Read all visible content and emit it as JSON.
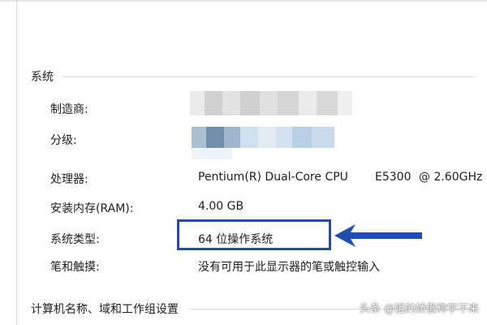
{
  "sections": {
    "system": "系统",
    "computer_name": "计算机名称、域和工作组设置"
  },
  "rows": {
    "manufacturer": {
      "label": "制造商:",
      "value": ""
    },
    "rating": {
      "label": "分级:",
      "value": ""
    },
    "processor": {
      "label": "处理器:",
      "value_main": "Pentium(R) Dual-Core  CPU",
      "value_model": "E5300",
      "value_speed": "@ 2.60GHz"
    },
    "ram": {
      "label": "安装内存(RAM):",
      "value": "4.00 GB"
    },
    "system_type": {
      "label": "系统类型:",
      "value": "64 位操作系统"
    },
    "pen_touch": {
      "label": "笔和触摸:",
      "value": "没有可用于此显示器的笔或触控输入"
    }
  },
  "annotation": {
    "highlight_color": "#1f4fae",
    "arrow_icon": "left-arrow-icon"
  },
  "watermark": "头条 @姐的娇傲称学不来"
}
